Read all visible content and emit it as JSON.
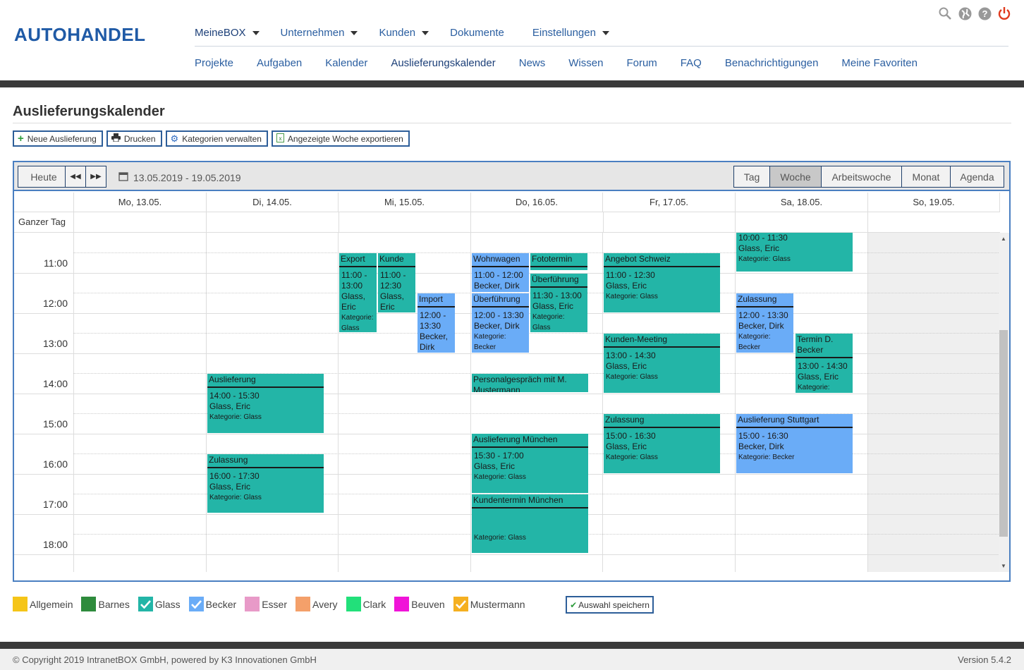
{
  "brand": "AUTOHANDEL",
  "nav_primary": [
    "MeineBOX",
    "Unternehmen",
    "Kunden",
    "Dokumente",
    "Einstellungen"
  ],
  "nav_secondary": [
    "Projekte",
    "Aufgaben",
    "Kalender",
    "Auslieferungskalender",
    "News",
    "Wissen",
    "Forum",
    "FAQ",
    "Benachrichtigungen",
    "Meine Favoriten"
  ],
  "page_title": "Auslieferungskalender",
  "actions": {
    "new": "Neue Auslieferung",
    "print": "Drucken",
    "categories": "Kategorien verwalten",
    "export": "Angezeigte Woche exportieren"
  },
  "toolbar": {
    "today": "Heute",
    "range": "13.05.2019 - 19.05.2019"
  },
  "views": [
    "Tag",
    "Woche",
    "Arbeitswoche",
    "Monat",
    "Agenda"
  ],
  "active_view": "Woche",
  "days": [
    "Mo, 13.05.",
    "Di, 14.05.",
    "Mi, 15.05.",
    "Do, 16.05.",
    "Fr, 17.05.",
    "Sa, 18.05.",
    "So, 19.05."
  ],
  "all_day_label": "Ganzer Tag",
  "times": [
    "11:00",
    "12:00",
    "13:00",
    "14:00",
    "15:00",
    "16:00",
    "17:00",
    "18:00"
  ],
  "events": [
    {
      "title": "",
      "lines": [
        "10:00 - 11:30",
        "Glass, Eric",
        "Kategorie: Glass"
      ],
      "color": "green",
      "headless": true
    },
    {
      "title": "Export",
      "lines": [
        "11:00 -",
        "13:00",
        "Glass,",
        "Eric",
        "Kategorie:",
        "Glass"
      ],
      "color": "green"
    },
    {
      "title": "Kunde",
      "lines": [
        "11:00 -",
        "12:30",
        "Glass,",
        "Eric"
      ],
      "color": "green"
    },
    {
      "title": "Import",
      "lines": [
        "12:00 -",
        "13:30",
        "Becker,",
        "Dirk"
      ],
      "color": "blue"
    },
    {
      "title": "Wohnwagen",
      "lines": [
        "11:00 - 12:00",
        "Becker, Dirk"
      ],
      "color": "blue"
    },
    {
      "title": "Fototermin",
      "lines": [],
      "color": "green"
    },
    {
      "title": "Überführung",
      "lines": [
        "11:30 - 13:00",
        "Glass, Eric",
        "Kategorie:",
        "Glass"
      ],
      "color": "green"
    },
    {
      "title": "Überführung",
      "lines": [
        "12:00 - 13:30",
        "Becker, Dirk",
        "Kategorie:",
        "Becker"
      ],
      "color": "blue"
    },
    {
      "title": "Angebot Schweiz",
      "lines": [
        "11:00 - 12:30",
        "Glass, Eric",
        "Kategorie: Glass"
      ],
      "color": "green"
    },
    {
      "title": "Zulassung",
      "lines": [
        "12:00 - 13:30",
        "Becker, Dirk",
        "Kategorie:",
        "Becker"
      ],
      "color": "blue"
    },
    {
      "title": "Kunden-Meeting",
      "lines": [
        "13:00 - 14:30",
        "Glass, Eric",
        "Kategorie: Glass"
      ],
      "color": "green"
    },
    {
      "title": "Termin D. Becker",
      "lines": [
        "13:00 - 14:30",
        "Glass, Eric",
        "Kategorie:"
      ],
      "color": "green"
    },
    {
      "title": "Auslieferung",
      "lines": [
        "14:00 - 15:30",
        "Glass, Eric",
        "Kategorie: Glass"
      ],
      "color": "green"
    },
    {
      "title": "Personalgespräch mit M. Mustermann",
      "lines": [],
      "color": "green"
    },
    {
      "title": "Zulassung",
      "lines": [
        "15:00 - 16:30",
        "Glass, Eric",
        "Kategorie: Glass"
      ],
      "color": "green"
    },
    {
      "title": "Auslieferung Stuttgart",
      "lines": [
        "15:00 - 16:30",
        "Becker, Dirk",
        "Kategorie: Becker"
      ],
      "color": "blue"
    },
    {
      "title": "Auslieferung München",
      "lines": [
        "15:30 - 17:00",
        "Glass, Eric",
        "Kategorie: Glass"
      ],
      "color": "green"
    },
    {
      "title": "Zulassung",
      "lines": [
        "16:00 - 17:30",
        "Glass, Eric",
        "Kategorie: Glass"
      ],
      "color": "green"
    },
    {
      "title": "Kundentermin München",
      "lines": [
        "",
        "",
        "Kategorie: Glass"
      ],
      "color": "green"
    }
  ],
  "legend": [
    {
      "label": "Allgemein",
      "color": "#f5c518",
      "checked": false
    },
    {
      "label": "Barnes",
      "color": "#2e8b3c",
      "checked": false
    },
    {
      "label": "Glass",
      "color": "#23b5a7",
      "checked": true
    },
    {
      "label": "Becker",
      "color": "#6aacf7",
      "checked": true
    },
    {
      "label": "Esser",
      "color": "#e89ac8",
      "checked": false
    },
    {
      "label": "Avery",
      "color": "#f4a06a",
      "checked": false
    },
    {
      "label": "Clark",
      "color": "#22e07a",
      "checked": false
    },
    {
      "label": "Beuven",
      "color": "#f014d8",
      "checked": false
    },
    {
      "label": "Mustermann",
      "color": "#f5b021",
      "checked": true
    }
  ],
  "save_selection": "Auswahl speichern",
  "footer": {
    "copyright": "© Copyright 2019 IntranetBOX GmbH, powered by K3 Innovationen GmbH",
    "version": "Version 5.4.2"
  }
}
